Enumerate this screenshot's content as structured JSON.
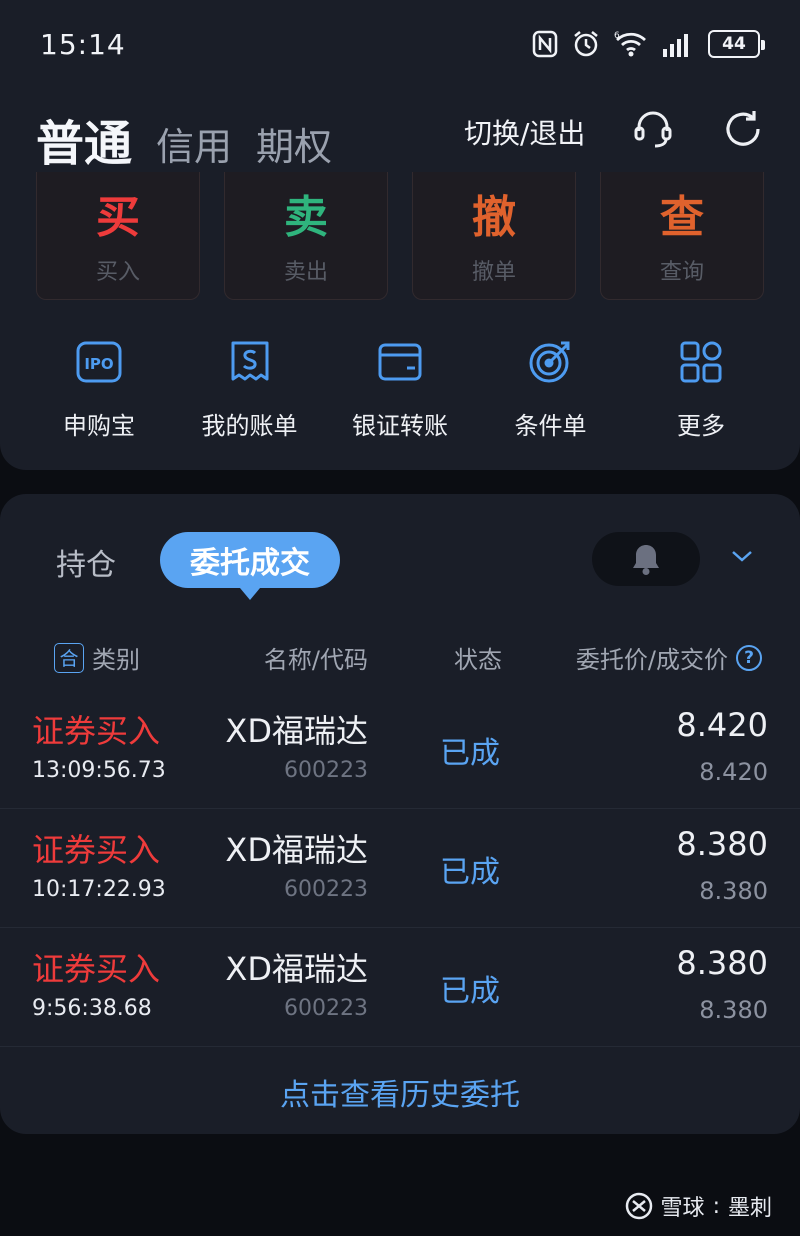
{
  "status_bar": {
    "time": "15:14",
    "battery": "44"
  },
  "header": {
    "tabs": [
      {
        "label": "普通",
        "active": true
      },
      {
        "label": "信用",
        "active": false
      },
      {
        "label": "期权",
        "active": false
      }
    ],
    "switch_exit": "切换/退出"
  },
  "trade_buttons": [
    {
      "big": "买",
      "small": "买入",
      "color": "#ee3b3b"
    },
    {
      "big": "卖",
      "small": "卖出",
      "color": "#2fb47d"
    },
    {
      "big": "撤",
      "small": "撤单",
      "color": "#e0622d"
    },
    {
      "big": "查",
      "small": "查询",
      "color": "#e0622d"
    }
  ],
  "quick_actions": [
    {
      "label": "申购宝",
      "icon": "ipo-icon",
      "icon_text": "IPO"
    },
    {
      "label": "我的账单",
      "icon": "bill-icon"
    },
    {
      "label": "银证转账",
      "icon": "wallet-icon"
    },
    {
      "label": "条件单",
      "icon": "target-icon"
    },
    {
      "label": "更多",
      "icon": "grid-icon"
    }
  ],
  "orders": {
    "tabs": {
      "holdings": "持仓",
      "active": "委托成交"
    },
    "columns": {
      "badge": "合",
      "type": "类别",
      "name": "名称/代码",
      "state": "状态",
      "price": "委托价/成交价",
      "help": "?"
    },
    "rows": [
      {
        "type": "证券买入",
        "time": "13:09:56.73",
        "name": "XD福瑞达",
        "code": "600223",
        "state": "已成",
        "price": "8.420",
        "deal": "8.420"
      },
      {
        "type": "证券买入",
        "time": "10:17:22.93",
        "name": "XD福瑞达",
        "code": "600223",
        "state": "已成",
        "price": "8.380",
        "deal": "8.380"
      },
      {
        "type": "证券买入",
        "time": "9:56:38.68",
        "name": "XD福瑞达",
        "code": "600223",
        "state": "已成",
        "price": "8.380",
        "deal": "8.380"
      }
    ],
    "history_link": "点击查看历史委托"
  },
  "watermark": {
    "brand": "雪球",
    "sep": ":",
    "author": "墨刺"
  },
  "colors": {
    "accent": "#5aa4f2",
    "buy_red": "#ee3b3b",
    "sell_green": "#2fb47d",
    "card_bg": "#1a1e28"
  }
}
